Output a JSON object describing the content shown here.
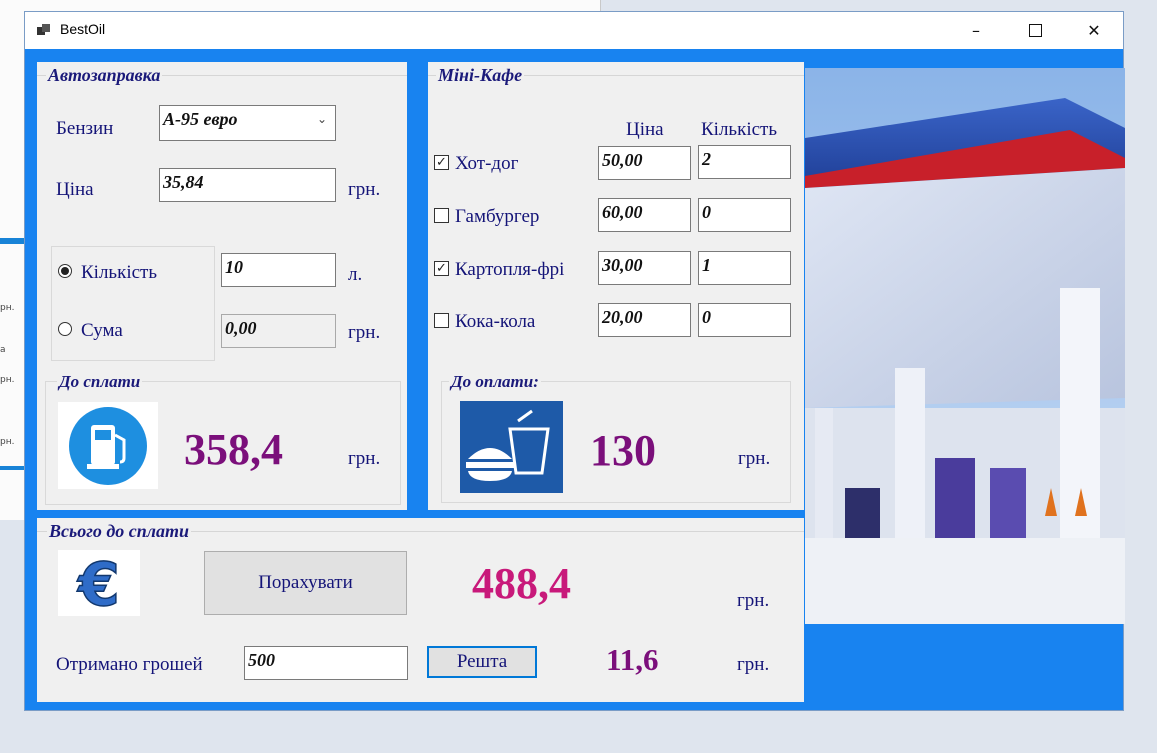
{
  "window": {
    "title": "BestOil"
  },
  "gas_station": {
    "title": "Автозаправка",
    "fuel_label": "Бензин",
    "fuel_selected": "А-95 евро",
    "price_label": "Ціна",
    "price_value": "35,84",
    "price_unit": "грн.",
    "quantity_label": "Кількість",
    "quantity_value": "10",
    "quantity_unit": "л.",
    "quantity_selected": true,
    "sum_label": "Сума",
    "sum_value": "0,00",
    "sum_unit": "грн.",
    "to_pay_title": "До сплати",
    "to_pay_value": "358,4",
    "to_pay_unit": "грн."
  },
  "cafe": {
    "title": "Міні-Кафе",
    "price_header": "Ціна",
    "quantity_header": "Кількість",
    "items": [
      {
        "name": "Хот-дог",
        "checked": true,
        "price": "50,00",
        "qty": "2"
      },
      {
        "name": "Гамбургер",
        "checked": false,
        "price": "60,00",
        "qty": "0"
      },
      {
        "name": "Картопля-фрі",
        "checked": true,
        "price": "30,00",
        "qty": "1"
      },
      {
        "name": "Кока-кола",
        "checked": false,
        "price": "20,00",
        "qty": "0"
      }
    ],
    "to_pay_title": "До оплати:",
    "to_pay_value": "130",
    "to_pay_unit": "грн."
  },
  "total": {
    "title": "Всього до сплати",
    "calculate_label": "Порахувати",
    "total_value": "488,4",
    "total_unit": "грн.",
    "received_label": "Отримано грошей",
    "received_value": "500",
    "change_button_label": "Решта",
    "change_value": "11,6",
    "change_unit": "грн."
  },
  "icons": {
    "fuel": "fuel-pump-icon",
    "food": "burger-drink-icon",
    "currency": "euro-icon",
    "app": "app-icon"
  },
  "colors": {
    "window_frame": "#1883f0",
    "panel": "#f0f0f0",
    "label": "#141478",
    "big_value": "#7b0f7b",
    "total_value": "#c8197a"
  },
  "bg_ticks": [
    "рн.",
    "рн.",
    "а",
    "рн.",
    "рн."
  ]
}
